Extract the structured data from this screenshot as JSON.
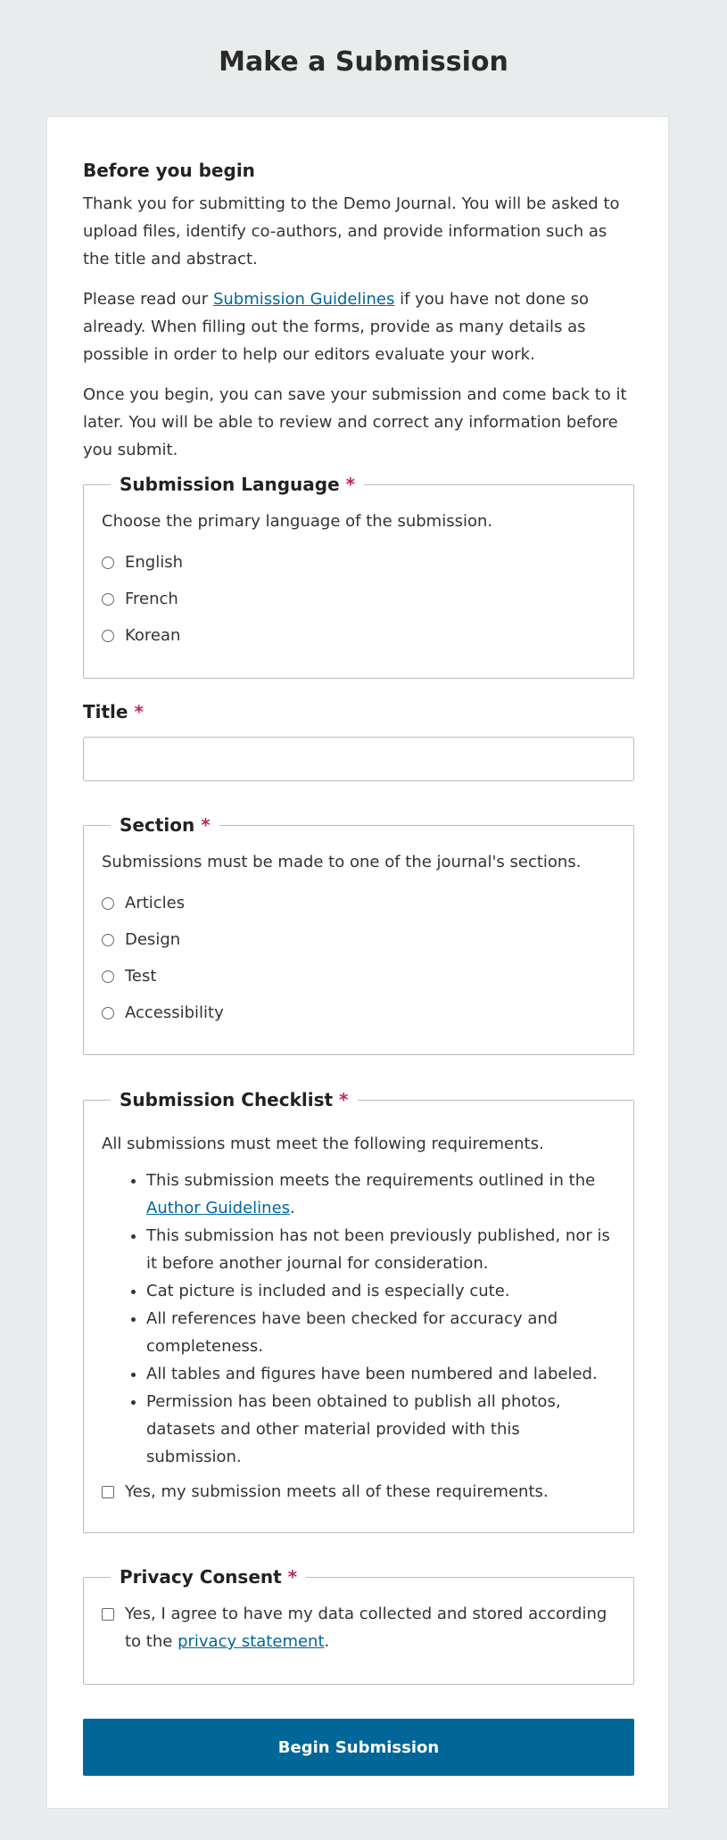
{
  "page_title": "Make a Submission",
  "intro": {
    "heading": "Before you begin",
    "p1": "Thank you for submitting to the Demo Journal. You will be asked to upload files, identify co-authors, and provide information such as the title and abstract.",
    "p2_before": "Please read our ",
    "p2_link": "Submission Guidelines",
    "p2_after": " if you have not done so already. When filling out the forms, provide as many details as possible in order to help our editors evaluate your work.",
    "p3": "Once you begin, you can save your submission and come back to it later. You will be able to review and correct any information before you submit."
  },
  "required_marker": "*",
  "language": {
    "legend": "Submission Language",
    "description": "Choose the primary language of the submission.",
    "options": [
      "English",
      "French",
      "Korean"
    ]
  },
  "title_field": {
    "label": "Title",
    "value": ""
  },
  "section": {
    "legend": "Section",
    "description": "Submissions must be made to one of the journal's sections.",
    "options": [
      "Articles",
      "Design",
      "Test",
      "Accessibility"
    ]
  },
  "checklist": {
    "legend": "Submission Checklist",
    "description": "All submissions must meet the following requirements.",
    "item1_before": "This submission meets the requirements outlined in the ",
    "item1_link": "Author Guidelines",
    "item1_after": ".",
    "items": [
      "This submission has not been previously published, nor is it before another journal for consideration.",
      "Cat picture is included and is especially cute.",
      "All references have been checked for accuracy and completeness.",
      "All tables and figures have been numbered and labeled.",
      "Permission has been obtained to publish all photos, datasets and other material provided with this submission."
    ],
    "confirm_label": "Yes, my submission meets all of these requirements."
  },
  "privacy": {
    "legend": "Privacy Consent",
    "label_before": "Yes, I agree to have my data collected and stored according to the ",
    "label_link": "privacy statement",
    "label_after": "."
  },
  "submit_label": "Begin Submission",
  "colors": {
    "primary": "#006798",
    "required": "#c1265b",
    "background": "#e9ecec"
  }
}
